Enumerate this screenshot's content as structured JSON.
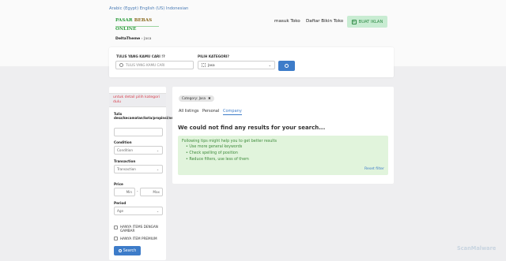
{
  "header": {
    "languages": "Arabic (Egypt) English (US) Indonesian",
    "logo_main": "PASAR",
    "logo_accent": " BEBAS",
    "logo_tail": " ONLINE",
    "login": "masuk Toko",
    "register": "Daftar Bikin Toko",
    "post_ad": "BUAT IKLAN"
  },
  "breadcrumb": {
    "home": "DeltaTheme",
    "sep": "›",
    "current": "Jasa"
  },
  "search": {
    "query_label": "TULIS YANG KAMU CARI !?",
    "query_placeholder": "TULIS YANG KAMU CARI",
    "category_label": "PILIH KATEGORI?",
    "category_value": "Jasa"
  },
  "sidebar": {
    "notice": "untuk detail pilih kategori dulu",
    "location_label": "Tulis desa/kecamatan/kota/propinsi/negara",
    "condition_label": "Condition",
    "condition_value": "Condition",
    "transaction_label": "Transaction",
    "transaction_value": "Transaction",
    "price_label": "Price",
    "price_min": "Min",
    "price_max": "Max",
    "price_sep": "-",
    "period_label": "Period",
    "period_value": "Age",
    "check1": "HANYA ITEMS DENGAN GAMBAR",
    "check2": "HANYA ITEM PREMIUM",
    "search_button": "Search"
  },
  "results": {
    "badge": "Category: Jasa",
    "badge_x": "✖",
    "tabs": [
      "All listings",
      "Personal",
      "Company"
    ],
    "active_tab": "Company",
    "title": "We could not find any results for your search...",
    "tips_intro": "Following tips might help you to get better results",
    "tips": [
      "Use more general keywords",
      "Check spelling of position",
      "Reduce filters, use less of them"
    ],
    "reset": "Reset filter"
  },
  "watermark": "ScanMalware",
  "colors": {
    "accent": "#3d7cc9",
    "green": "#2e9e3e",
    "alert": "#d83d4a"
  }
}
